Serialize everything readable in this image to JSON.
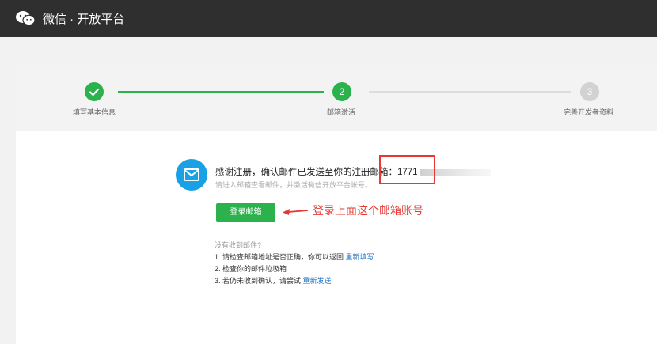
{
  "header": {
    "brand": "微信 · 开放平台",
    "logo_icon": "wechat-logo-icon"
  },
  "steps": {
    "items": [
      {
        "number": "",
        "label": "填写基本信息",
        "state": "done",
        "icon": "check-icon"
      },
      {
        "number": "2",
        "label": "邮箱激活",
        "state": "active"
      },
      {
        "number": "3",
        "label": "完善开发者资料",
        "state": "pending"
      }
    ]
  },
  "main": {
    "mail_icon": "envelope-icon",
    "message_prefix": "感谢注册，确认邮件已发送至你的注册邮箱：",
    "email_visible": "1771",
    "sub_message": "请进入邮箱查看邮件，并激活微信开放平台帐号。",
    "login_button": "登录邮箱"
  },
  "annotation": {
    "text": "登录上面这个邮箱账号",
    "color": "#e53935"
  },
  "help": {
    "title": "没有收到邮件?",
    "line1": "1. 请检查邮箱地址是否正确，你可以返回",
    "line1_link": "重新填写",
    "line2": "2. 检查你的邮件垃圾箱",
    "line3": "3. 若仍未收到确认，请尝试",
    "line3_link": "重新发送"
  },
  "colors": {
    "primary_green": "#2bb24c",
    "topbar": "#2f2f2f",
    "mail_blue": "#1aa1e3",
    "link": "#1a73c9"
  }
}
